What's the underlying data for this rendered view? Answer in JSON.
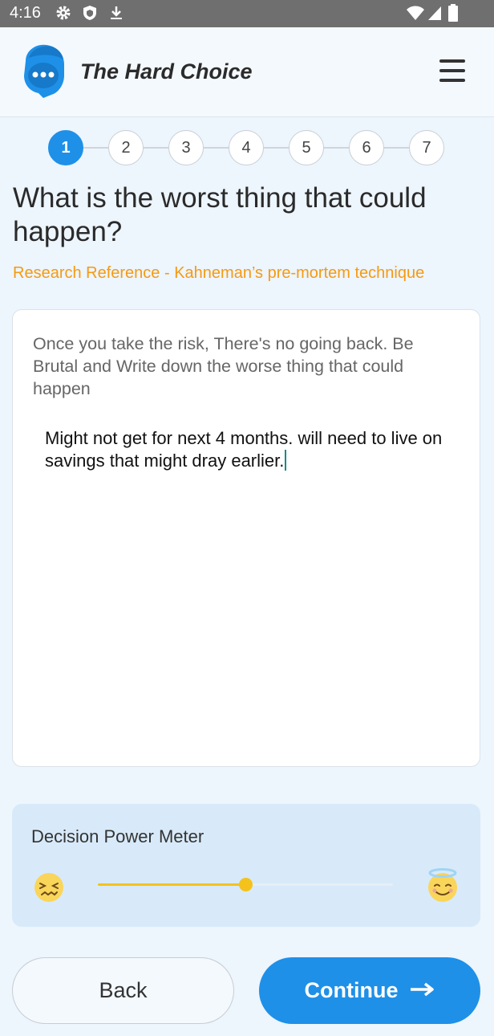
{
  "status_bar": {
    "time": "4:16",
    "left_icons": [
      "gear-icon",
      "shield-icon",
      "download-icon"
    ],
    "right_icons": [
      "wifi-icon",
      "signal-icon",
      "battery-icon"
    ]
  },
  "app": {
    "title": "The Hard Choice",
    "logo_icon": "chat-head-icon",
    "menu_icon": "hamburger-menu-icon"
  },
  "stepper": {
    "steps": [
      "1",
      "2",
      "3",
      "4",
      "5",
      "6",
      "7"
    ],
    "active_step": "1"
  },
  "question": {
    "title": "What is the worst thing that could happen?",
    "reference": "Research Reference - Kahneman’s pre-mortem technique"
  },
  "card": {
    "instructions": "Once you take the risk, There's no going back. Be Brutal and Write down the worse thing that could happen",
    "answer": "Might not get for next 4 months. will need to live on savings that might dray earlier."
  },
  "meter": {
    "label": "Decision Power Meter",
    "value": 0.5,
    "left_icon": "confounded-face-icon",
    "right_icon": "halo-face-icon"
  },
  "buttons": {
    "back": "Back",
    "continue": "Continue",
    "continue_icon": "arrow-right-icon"
  },
  "colors": {
    "primary": "#1e90e8",
    "accent": "#f59a12",
    "slider": "#f5c21c",
    "background": "#edf5fd"
  }
}
